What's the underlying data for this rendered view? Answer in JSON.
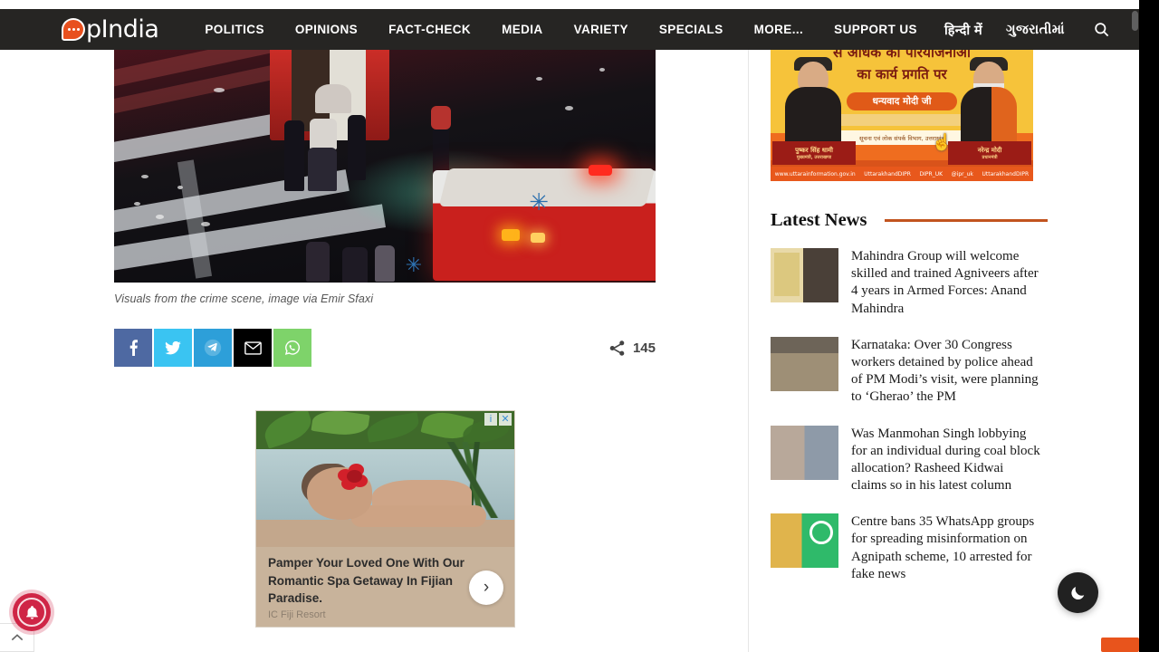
{
  "site": {
    "logo_text": "pIndia",
    "logo_icon": "speech-bubble-icon"
  },
  "nav": {
    "items": [
      {
        "label": "POLITICS"
      },
      {
        "label": "OPINIONS"
      },
      {
        "label": "FACT-CHECK"
      },
      {
        "label": "MEDIA"
      },
      {
        "label": "VARIETY"
      },
      {
        "label": "SPECIALS"
      },
      {
        "label": "MORE..."
      },
      {
        "label": "SUPPORT US"
      }
    ],
    "languages": [
      {
        "label": "हिन्दी में"
      },
      {
        "label": "ગુજરાતીમાં"
      }
    ],
    "search_icon": "search-icon"
  },
  "article": {
    "image_caption": "Visuals from the crime scene, image via Emir Sfaxi",
    "share": {
      "count": "145",
      "share_icon": "share-icon",
      "buttons": [
        {
          "name": "facebook",
          "glyph": "f",
          "color": "#4e69a2"
        },
        {
          "name": "twitter",
          "glyph": "t",
          "color": "#3ac4f2"
        },
        {
          "name": "telegram",
          "glyph": "tg",
          "color": "#2d9fd9"
        },
        {
          "name": "email",
          "glyph": "envelope",
          "color": "#000000"
        },
        {
          "name": "whatsapp",
          "glyph": "wa",
          "color": "#7ed36a"
        }
      ]
    }
  },
  "inline_ad": {
    "headline": "Pamper Your Loved One With Our Romantic Spa Getaway In Fijian Paradise.",
    "advertiser": "IC Fiji Resort",
    "next_label": "›",
    "info_label": "i",
    "close_label": "✕"
  },
  "side_ad": {
    "line1": "से अधिक की परियोजनाओ",
    "line2": "का कार्य प्रगति पर",
    "badge": "धन्यवाद मोदी जी",
    "subtext": "सूचना एवं लोक संपर्क विभाग, उत्तराखंड",
    "left_name": "पुष्कर सिंह धामी",
    "left_role": "मुख्यमंत्री, उत्तराखण्ड",
    "right_name": "नरेन्द्र मोदी",
    "right_role": "प्रधानमंत्री",
    "footer": [
      "www.uttarainformation.gov.in",
      "UttarakhandDIPR",
      "DIPR_UK",
      "@ipr_uk",
      "UttarakhandDIPR"
    ]
  },
  "sidebar": {
    "latest_news_title": "Latest News",
    "news_items": [
      {
        "title": "Mahindra Group will welcome skilled and trained Agniveers after 4 years in Armed Forces: Anand Mahindra"
      },
      {
        "title": "Karnataka: Over 30 Congress workers detained by police ahead of PM Modi’s visit, were planning to ‘Gherao’ the PM"
      },
      {
        "title": "Was Manmohan Singh lobbying for an individual during coal block allocation? Rasheed Kidwai claims so in his latest column"
      },
      {
        "title": "Centre bans 35 WhatsApp groups for spreading misinformation on Agnipath scheme, 10 arrested for fake news"
      }
    ]
  },
  "widgets": {
    "notification_icon": "bell-icon",
    "scroll_top_icon": "chevron-up-icon",
    "dark_mode_icon": "moon-icon"
  },
  "colors": {
    "nav_bg": "#262523",
    "accent_orange": "#c2541f",
    "brand_orange": "#e8501e"
  }
}
